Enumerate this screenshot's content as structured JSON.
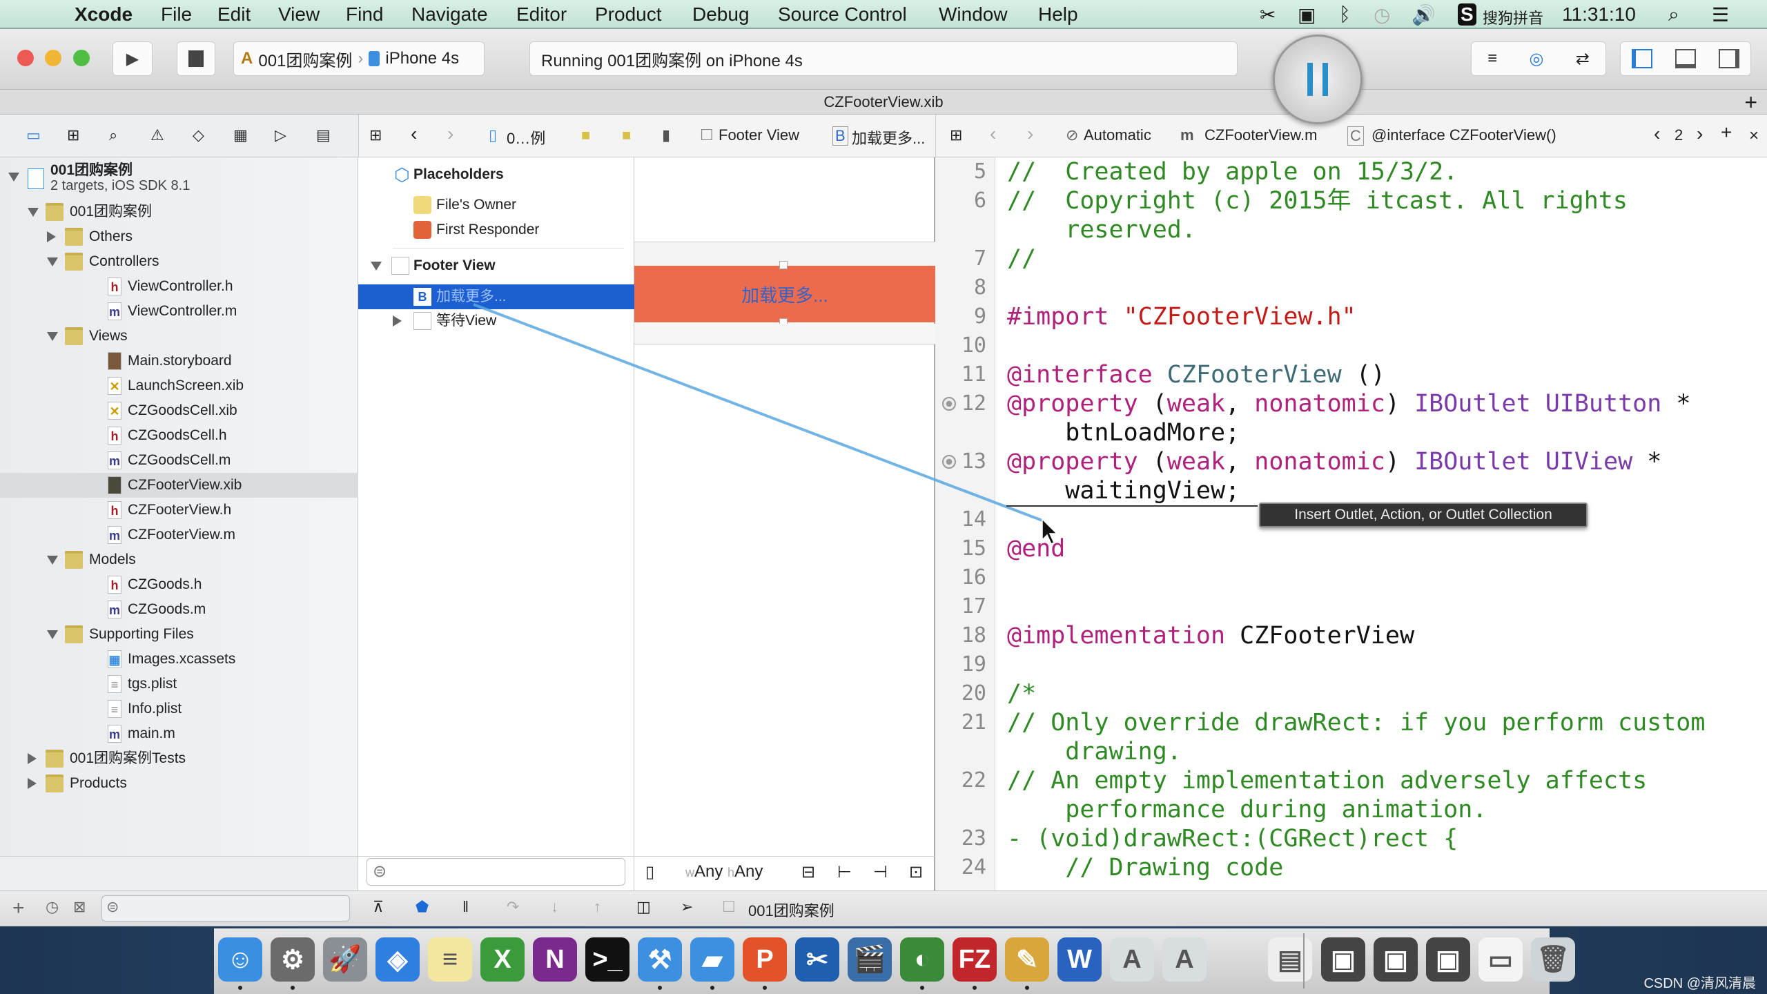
{
  "menubar": {
    "apple": "",
    "items": [
      "Xcode",
      "File",
      "Edit",
      "View",
      "Find",
      "Navigate",
      "Editor",
      "Product",
      "Debug",
      "Source Control",
      "Window",
      "Help"
    ],
    "ime": "搜狗拼音",
    "clock": "11:31:10"
  },
  "toolbar": {
    "scheme": "001团购案例",
    "device": "iPhone 4s",
    "status": "Running 001团购案例 on iPhone 4s"
  },
  "tab": {
    "title": "CZFooterView.xib"
  },
  "ib_jumpbar": {
    "crumbs": [
      "0…例",
      "Footer View",
      "加载更多..."
    ]
  },
  "code_jumpbar": {
    "mode": "Automatic",
    "file": "CZFooterView.m",
    "symbol": "@interface CZFooterView()",
    "counter": "2"
  },
  "navigator": {
    "project": {
      "name": "001团购案例",
      "subtitle": "2 targets, iOS SDK 8.1"
    },
    "items": [
      {
        "label": "001团购案例",
        "depth": 1,
        "kind": "folder",
        "disclosure": "down"
      },
      {
        "label": "Others",
        "depth": 2,
        "kind": "folder",
        "disclosure": "right"
      },
      {
        "label": "Controllers",
        "depth": 2,
        "kind": "folder",
        "disclosure": "down"
      },
      {
        "label": "ViewController.h",
        "depth": 3,
        "kind": "h"
      },
      {
        "label": "ViewController.m",
        "depth": 3,
        "kind": "m"
      },
      {
        "label": "Views",
        "depth": 2,
        "kind": "folder",
        "disclosure": "down"
      },
      {
        "label": "Main.storyboard",
        "depth": 3,
        "kind": "storyboard"
      },
      {
        "label": "LaunchScreen.xib",
        "depth": 3,
        "kind": "xib"
      },
      {
        "label": "CZGoodsCell.xib",
        "depth": 3,
        "kind": "xib"
      },
      {
        "label": "CZGoodsCell.h",
        "depth": 3,
        "kind": "h"
      },
      {
        "label": "CZGoodsCell.m",
        "depth": 3,
        "kind": "m"
      },
      {
        "label": "CZFooterView.xib",
        "depth": 3,
        "kind": "xib-dark",
        "selected": true
      },
      {
        "label": "CZFooterView.h",
        "depth": 3,
        "kind": "h"
      },
      {
        "label": "CZFooterView.m",
        "depth": 3,
        "kind": "m"
      },
      {
        "label": "Models",
        "depth": 2,
        "kind": "folder",
        "disclosure": "down"
      },
      {
        "label": "CZGoods.h",
        "depth": 3,
        "kind": "h"
      },
      {
        "label": "CZGoods.m",
        "depth": 3,
        "kind": "m"
      },
      {
        "label": "Supporting Files",
        "depth": 2,
        "kind": "folder",
        "disclosure": "down"
      },
      {
        "label": "Images.xcassets",
        "depth": 3,
        "kind": "assets"
      },
      {
        "label": "tgs.plist",
        "depth": 3,
        "kind": "plist"
      },
      {
        "label": "Info.plist",
        "depth": 3,
        "kind": "plist"
      },
      {
        "label": "main.m",
        "depth": 3,
        "kind": "m"
      },
      {
        "label": "001团购案例Tests",
        "depth": 1,
        "kind": "folder",
        "disclosure": "right"
      },
      {
        "label": "Products",
        "depth": 1,
        "kind": "folder",
        "disclosure": "right"
      }
    ]
  },
  "outline": {
    "placeholders": "Placeholders",
    "files_owner": "File's Owner",
    "first_responder": "First Responder",
    "footer_view": "Footer View",
    "button": "加载更多...",
    "waiting_view": "等待View"
  },
  "canvas": {
    "button_title": "加载更多...",
    "button_color": "#ec6b4d",
    "size_w": "Any",
    "size_h": "Any",
    "w_prefix": "w",
    "h_prefix": "h"
  },
  "code": [
    {
      "n": "5",
      "s": [
        [
          "cmt",
          "//  Created by apple on 15/3/2."
        ]
      ]
    },
    {
      "n": "6",
      "s": [
        [
          "cmt",
          "//  Copyright (c) 2015年 itcast. All rights"
        ]
      ]
    },
    {
      "n": "",
      "s": [
        [
          "cmt",
          "    reserved."
        ]
      ]
    },
    {
      "n": "7",
      "s": [
        [
          "cmt",
          "//"
        ]
      ]
    },
    {
      "n": "8",
      "s": []
    },
    {
      "n": "9",
      "s": [
        [
          "kw",
          "#import "
        ],
        [
          "str",
          "\"CZFooterView.h\""
        ]
      ]
    },
    {
      "n": "10",
      "s": []
    },
    {
      "n": "11",
      "s": [
        [
          "kw",
          "@interface "
        ],
        [
          "cls",
          "CZFooterView"
        ],
        [
          "plain",
          " ()"
        ]
      ]
    },
    {
      "n": "12",
      "s": [
        [
          "kw",
          "@property "
        ],
        [
          "plain",
          "("
        ],
        [
          "kw",
          "weak"
        ],
        [
          "plain",
          ", "
        ],
        [
          "kw",
          "nonatomic"
        ],
        [
          "plain",
          ") "
        ],
        [
          "type",
          "IBOutlet UIButton"
        ],
        [
          "plain",
          " *"
        ]
      ],
      "outlet": true
    },
    {
      "n": "",
      "s": [
        [
          "plain",
          "    btnLoadMore;"
        ]
      ]
    },
    {
      "n": "13",
      "s": [
        [
          "kw",
          "@property "
        ],
        [
          "plain",
          "("
        ],
        [
          "kw",
          "weak"
        ],
        [
          "plain",
          ", "
        ],
        [
          "kw",
          "nonatomic"
        ],
        [
          "plain",
          ") "
        ],
        [
          "type",
          "IBOutlet UIView"
        ],
        [
          "plain",
          " *"
        ]
      ],
      "outlet": true
    },
    {
      "n": "",
      "s": [
        [
          "plain",
          "    waitingView;"
        ]
      ]
    },
    {
      "n": "14",
      "s": []
    },
    {
      "n": "15",
      "s": [
        [
          "kw",
          "@end"
        ]
      ]
    },
    {
      "n": "16",
      "s": []
    },
    {
      "n": "17",
      "s": []
    },
    {
      "n": "18",
      "s": [
        [
          "kw",
          "@implementation "
        ],
        [
          "plain",
          "CZFooterView"
        ]
      ]
    },
    {
      "n": "19",
      "s": []
    },
    {
      "n": "20",
      "s": [
        [
          "cmt",
          "/*"
        ]
      ]
    },
    {
      "n": "21",
      "s": [
        [
          "cmt",
          "// Only override drawRect: if you perform custom"
        ]
      ]
    },
    {
      "n": "",
      "s": [
        [
          "cmt",
          "    drawing."
        ]
      ]
    },
    {
      "n": "22",
      "s": [
        [
          "cmt",
          "// An empty implementation adversely affects"
        ]
      ]
    },
    {
      "n": "",
      "s": [
        [
          "cmt",
          "    performance during animation."
        ]
      ]
    },
    {
      "n": "23",
      "s": [
        [
          "cmt",
          "- (void)drawRect:(CGRect)rect {"
        ]
      ]
    },
    {
      "n": "24",
      "s": [
        [
          "cmt",
          "    // Drawing code"
        ]
      ]
    }
  ],
  "tooltip": "Insert Outlet, Action, or Outlet Collection",
  "debugbar": {
    "target": "001团购案例"
  },
  "dock": [
    {
      "name": "finder",
      "color": "#3b8fe0",
      "glyph": "☺"
    },
    {
      "name": "system-preferences",
      "color": "#6b6b6b",
      "glyph": "⚙"
    },
    {
      "name": "launchpad",
      "color": "#8a8f96",
      "glyph": "🚀"
    },
    {
      "name": "safari",
      "color": "#2f7fe0",
      "glyph": "◈"
    },
    {
      "name": "notes",
      "color": "#f3e7a0",
      "glyph": "≡"
    },
    {
      "name": "excel",
      "color": "#3b9a3b",
      "glyph": "X"
    },
    {
      "name": "onenote",
      "color": "#7a2a8c",
      "glyph": "N"
    },
    {
      "name": "terminal",
      "color": "#111111",
      "glyph": ">_"
    },
    {
      "name": "xcode",
      "color": "#3d8fe0",
      "glyph": "⚒"
    },
    {
      "name": "folder",
      "color": "#3d8fe0",
      "glyph": "▰"
    },
    {
      "name": "powerpoint",
      "color": "#e2532a",
      "glyph": "P"
    },
    {
      "name": "scissors-app",
      "color": "#1e5fb0",
      "glyph": "✂"
    },
    {
      "name": "video-app",
      "color": "#3a6ea8",
      "glyph": "🎬"
    },
    {
      "name": "globe-app",
      "color": "#3a8a3a",
      "glyph": "◐"
    },
    {
      "name": "filezilla",
      "color": "#c0262a",
      "glyph": "FZ"
    },
    {
      "name": "instruments",
      "color": "#d8a63a",
      "glyph": "✎"
    },
    {
      "name": "word",
      "color": "#2a62c0",
      "glyph": "W"
    },
    {
      "name": "app-a",
      "color": "#d8dde0",
      "glyph": "A"
    },
    {
      "name": "app-a",
      "color": "#d8dde0",
      "glyph": "A"
    },
    {
      "name": "document",
      "color": "#eeeeee",
      "glyph": "▤"
    },
    {
      "name": "screen-recording",
      "color": "#444444",
      "glyph": "▣"
    },
    {
      "name": "screen-recording",
      "color": "#444444",
      "glyph": "▣"
    },
    {
      "name": "screen-recording",
      "color": "#444444",
      "glyph": "▣"
    },
    {
      "name": "document",
      "color": "#f4f4f4",
      "glyph": "▭"
    },
    {
      "name": "trash",
      "color": "#cfd4d8",
      "glyph": "🗑"
    }
  ],
  "watermark": "CSDN @清风清晨"
}
